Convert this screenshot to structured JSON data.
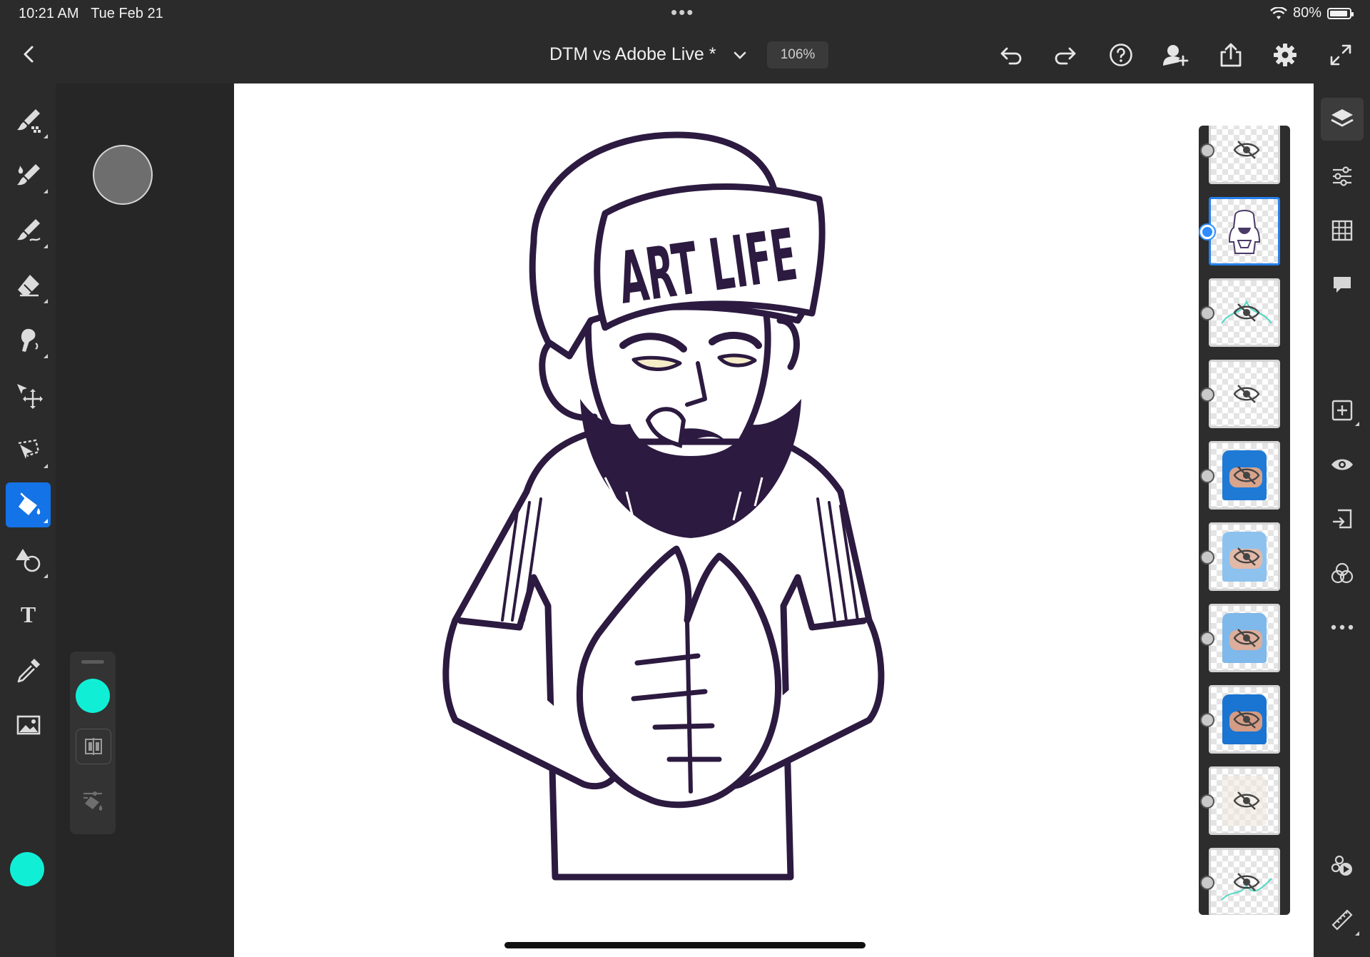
{
  "status_bar": {
    "time": "10:21 AM",
    "date": "Tue Feb 21",
    "battery": "80%",
    "battery_level": 0.8,
    "multitask_dots": "•••"
  },
  "header": {
    "document_title": "DTM vs Adobe Live *",
    "zoom": "106%"
  },
  "toolbar": {
    "icons": [
      "undo-icon",
      "redo-icon",
      "help-icon",
      "invite-icon",
      "share-icon",
      "settings-icon",
      "fullscreen-icon"
    ]
  },
  "tools": [
    {
      "name": "pixel-brush-tool",
      "icon": "pixel-brush-icon"
    },
    {
      "name": "live-brush-tool",
      "icon": "live-brush-icon"
    },
    {
      "name": "vector-brush-tool",
      "icon": "vector-brush-icon"
    },
    {
      "name": "eraser-tool",
      "icon": "eraser-icon"
    },
    {
      "name": "smudge-tool",
      "icon": "smudge-icon"
    },
    {
      "name": "transform-tool",
      "icon": "move-icon"
    },
    {
      "name": "selection-tool",
      "icon": "lasso-icon"
    },
    {
      "name": "fill-tool",
      "icon": "paint-bucket-icon",
      "active": true
    },
    {
      "name": "shapes-tool",
      "icon": "shapes-icon"
    },
    {
      "name": "text-tool",
      "icon": "text-icon",
      "glyph": "T"
    },
    {
      "name": "eyedropper-tool",
      "icon": "eyedropper-icon"
    },
    {
      "name": "place-image-tool",
      "icon": "image-icon"
    }
  ],
  "colors": {
    "current": "#10efd6",
    "fill_swatch": "#10efd6",
    "ink": "#2c1a40",
    "accent": "#1473e6"
  },
  "artwork": {
    "cap_text": "ART LIFE"
  },
  "layers": [
    {
      "thumb": "empty",
      "hidden": true
    },
    {
      "thumb": "line-art",
      "hidden": false,
      "selected": true
    },
    {
      "thumb": "teal-sketch",
      "hidden": true
    },
    {
      "thumb": "empty",
      "hidden": true
    },
    {
      "thumb": "blue-shirt",
      "hidden": true
    },
    {
      "thumb": "light-blue-shirt",
      "hidden": true
    },
    {
      "thumb": "light-blue-shirt",
      "hidden": true
    },
    {
      "thumb": "blue-shirt",
      "hidden": true
    },
    {
      "thumb": "faint",
      "hidden": true
    },
    {
      "thumb": "teal-sketch",
      "hidden": true
    }
  ],
  "right_tools": [
    "layers-icon",
    "adjustments-icon",
    "grid-icon",
    "comments-icon",
    "add-layer-icon",
    "visibility-icon",
    "import-icon",
    "blend-icon",
    "more-icon",
    "livestream-icon",
    "ruler-icon"
  ]
}
